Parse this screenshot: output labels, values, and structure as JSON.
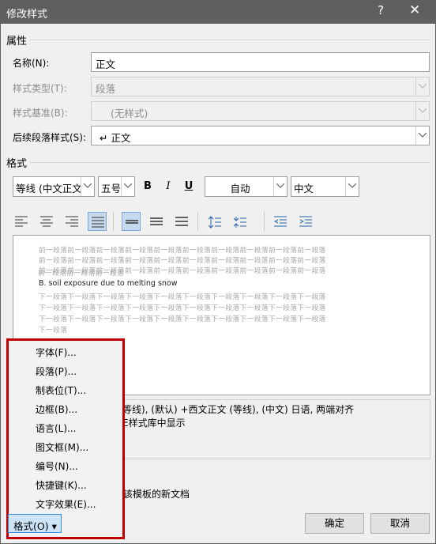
{
  "window": {
    "title": "修改样式",
    "help": "?",
    "close": "✕"
  },
  "properties": {
    "heading": "属性",
    "name_label": "名称(N):",
    "name_value": "正文",
    "type_label": "样式类型(T):",
    "type_value": "段落",
    "base_label": "样式基准(B):",
    "base_value": "(无样式)",
    "next_label": "后续段落样式(S):",
    "next_value": "↵ 正文"
  },
  "format": {
    "heading": "格式",
    "font": "等线 (中文正文)",
    "size": "五号",
    "bold": "B",
    "italic": "I",
    "underline": "U",
    "color": "自动",
    "language": "中文"
  },
  "preview": {
    "prev_lines": [
      "前一段落前一段落前一段落前一段落前一段落前一段落前一段落前一段落前一段落前一段落",
      "前一段落前一段落前一段落前一段落前一段落前一段落前一段落前一段落前一段落前一段落",
      "前一段落前一段落前一段落前一段落前一段落前一段落前一段落前一段落前一段落前一段落",
      "前一段落前一段落前一段落"
    ],
    "sample": "B. soil exposure due to melting snow",
    "next_lines": [
      "下一段落下一段落下一段落下一段落下一段落下一段落下一段落下一段落下一段落下一段落",
      "下一段落下一段落下一段落下一段落下一段落下一段落下一段落下一段落下一段落下一段落",
      "下一段落下一段落下一段落下一段落下一段落下一段落下一段落下一段落下一段落下一段落",
      "下一段落"
    ]
  },
  "description": {
    "line1": "等线), (默认) +西文正文 (等线), (中文) 日语, 两端对齐",
    "line2": "E样式库中显示"
  },
  "options": {
    "new_doc_text": "该模板的新文档"
  },
  "menu": {
    "items": [
      "字体(F)...",
      "段落(P)...",
      "制表位(T)...",
      "边框(B)...",
      "语言(L)...",
      "图文框(M)...",
      "编号(N)...",
      "快捷键(K)...",
      "文字效果(E)..."
    ],
    "button": "格式(O) ▾"
  },
  "buttons": {
    "ok": "确定",
    "cancel": "取消"
  },
  "colors": {
    "titlebar": "#5f5f5f",
    "highlight": "#c00000",
    "active": "#c5d9ef"
  }
}
